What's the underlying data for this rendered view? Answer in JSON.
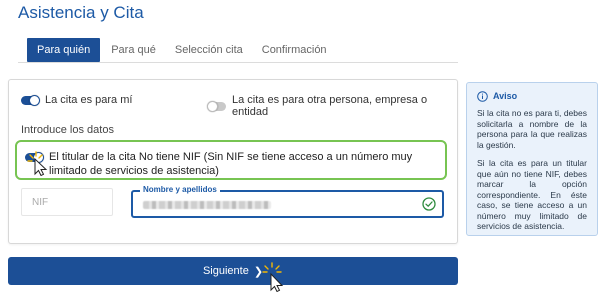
{
  "page": {
    "title": "Asistencia y Cita"
  },
  "tabs": [
    {
      "label": "Para quién",
      "active": true
    },
    {
      "label": "Para qué",
      "active": false
    },
    {
      "label": "Selección cita",
      "active": false
    },
    {
      "label": "Confirmación",
      "active": false
    }
  ],
  "form": {
    "toggle_self": {
      "label": "La cita es para mí",
      "on": true
    },
    "toggle_other": {
      "label": "La cita es para otra persona, empresa o entidad",
      "on": false
    },
    "section_label": "Introduce los datos",
    "toggle_no_nif": {
      "label": "El titular de la cita No tiene NIF (Sin NIF se tiene acceso a un número muy limitado de servicios de asistencia)",
      "on": true
    },
    "nif_field": {
      "placeholder": "NIF"
    },
    "name_field": {
      "label": "Nombre y apellidos",
      "value": ""
    }
  },
  "aviso": {
    "title": "Aviso",
    "paragraph_1": "Si la cita no es para ti, debes solicitarla a nombre de la persona para la que realizas la gestión.",
    "paragraph_2": "Si la cita es para un titular que aún no tiene NIF, debes marcar la opción correspondiente. En éste caso, se tiene acceso a un número muy limitado de servicios de asistencia."
  },
  "actions": {
    "next_label": "Siguiente"
  },
  "colors": {
    "primary": "#1c4f96",
    "highlight": "#77c452",
    "aviso_bg": "#eaf2fb",
    "success": "#2e8b3e"
  },
  "icons": {
    "aviso": "info-circle-icon",
    "valid": "check-circle-icon",
    "next": "chevron-right-icon"
  }
}
